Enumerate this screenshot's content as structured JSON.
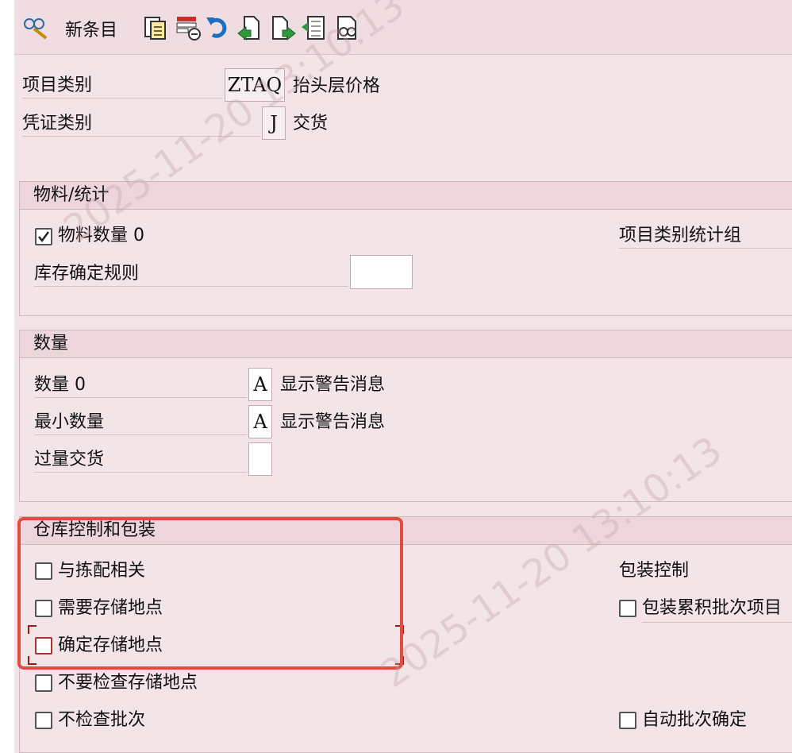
{
  "toolbar": {
    "new_entries_label": "新条目",
    "icons": [
      "display-change-icon",
      "copy-icon",
      "delete-icon",
      "undo-icon",
      "previous-entry-icon",
      "next-entry-icon",
      "select-all-icon",
      "find-icon"
    ]
  },
  "header_fields": {
    "item_category": {
      "label": "项目类别",
      "value": "ZTAQ",
      "description": "抬头层价格"
    },
    "doc_category": {
      "label": "凭证类别",
      "value": "J",
      "description": "交货"
    }
  },
  "material_stats": {
    "title": "物料/统计",
    "material_qty_zero": {
      "label": "物料数量 0",
      "checked": true
    },
    "stat_group_label": "项目类别统计组",
    "stock_rule_label": "库存确定规则",
    "stock_rule_value": ""
  },
  "quantity": {
    "title": "数量",
    "rows": [
      {
        "label": "数量 0",
        "value": "A",
        "description": "显示警告消息"
      },
      {
        "label": "最小数量",
        "value": "A",
        "description": "显示警告消息"
      },
      {
        "label": "过量交货",
        "value": "",
        "description": ""
      }
    ]
  },
  "warehouse": {
    "title": "仓库控制和包装",
    "relevant_for_picking": {
      "label": "与拣配相关",
      "checked": false
    },
    "storage_loc_required": {
      "label": "需要存储地点",
      "checked": false
    },
    "determine_storage_loc": {
      "label": "确定存储地点",
      "checked": false
    },
    "no_storage_loc_check": {
      "label": "不要检查存储地点",
      "checked": false
    },
    "no_batch_check": {
      "label": "不检查批次",
      "checked": false
    },
    "packing_control_label": "包装控制",
    "pack_accum_batch": {
      "label": "包装累积批次项目",
      "checked": false
    },
    "auto_batch_determination": {
      "label": "自动批次确定",
      "checked": false
    }
  },
  "watermark": "2025-11-20 13:10:13",
  "colors": {
    "highlight": "#e24b3f",
    "background": "#f2e4e7"
  }
}
